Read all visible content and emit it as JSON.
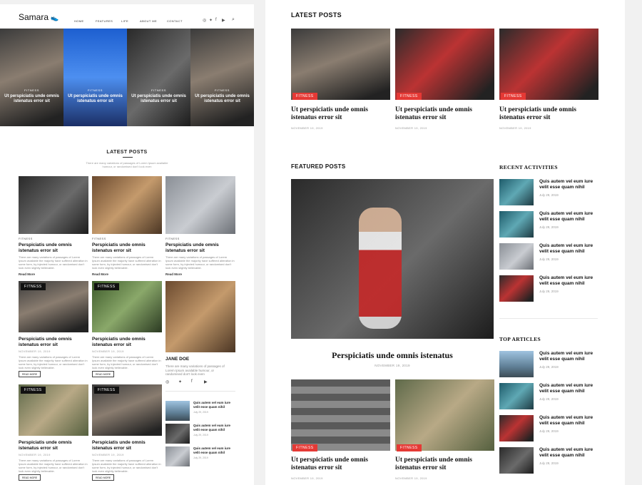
{
  "left": {
    "logo": "Samara",
    "nav": [
      "HOME",
      "FEATURES",
      "LIFE",
      "ABOUT ME",
      "CONTACT"
    ],
    "social_icons": [
      "instagram-icon",
      "twitter-icon",
      "facebook-icon",
      "youtube-icon"
    ],
    "hero": [
      {
        "cat": "FITNESS",
        "title": "Ut perspiciatis unde omnis istenatus error sit"
      },
      {
        "cat": "FITNESS",
        "title": "Ut perspiciatis unde omnis istenatus error sit"
      },
      {
        "cat": "FITNESS",
        "title": "Ut perspiciatis unde omnis istenatus error sit"
      },
      {
        "cat": "FITNESS",
        "title": "Ut perspiciatis unde omnis istenatus error sit"
      }
    ],
    "latest_heading": "LATEST POSTS",
    "latest_sub": "There are many variations of passages of Lorem Ipsum available humour, or randomised don't look even",
    "grid_row1": [
      {
        "cat": "FITNESS",
        "title": "Perspiciatis unde omnis istenatus error sit",
        "excerpt": "There are many variations of passages of Lorem Ipsum available the majority have suffered alteration in some form, by injected humour, or randomised don't look even slightly believable.",
        "more": "Read More"
      },
      {
        "cat": "FITNESS",
        "title": "Perspiciatis unde omnis istenatus error sit",
        "excerpt": "There are many variations of passages of Lorem Ipsum available the majority have suffered alteration in some form, by injected humour, or randomised don't look even slightly believable.",
        "more": "Read More"
      },
      {
        "cat": "FITNESS",
        "title": "Perspiciatis unde omnis istenatus error sit",
        "excerpt": "There are many variations of passages of Lorem Ipsum available the majority have suffered alteration in some form, by injected humour, or randomised don't look even slightly believable.",
        "more": "Read More"
      }
    ],
    "grid_row2": [
      {
        "cat": "FITNESS",
        "title": "Perspiciatis unde omnis istenatus error sit",
        "date": "NOVEMBER 19, 2019",
        "excerpt": "There are many variations of passages of Lorem Ipsum available the majority have suffered alteration in some form, by injected humour, or randomised don't look even slightly believable.",
        "more": "READ MORE"
      },
      {
        "cat": "FITNESS",
        "title": "Perspiciatis unde omnis istenatus error sit",
        "date": "NOVEMBER 19, 2019",
        "excerpt": "There are many variations of passages of Lorem Ipsum available the majority have suffered alteration in some form, by injected humour, or randomised don't look even slightly believable.",
        "more": "READ MORE"
      }
    ],
    "grid_row3": [
      {
        "cat": "FITNESS",
        "title": "Perspiciatis unde omnis istenatus error sit",
        "date": "NOVEMBER 19, 2019",
        "excerpt": "There are many variations of passages of Lorem Ipsum available the majority have suffered alteration in some form, by injected humour, or randomised don't look even slightly believable.",
        "more": "READ MORE"
      },
      {
        "cat": "FITNESS",
        "title": "Perspiciatis unde omnis istenatus error sit",
        "date": "NOVEMBER 19, 2019",
        "excerpt": "There are many variations of passages of Lorem Ipsum available the majority have suffered alteration in some form, by injected humour, or randomised don't look even slightly believable.",
        "more": "READ MORE"
      }
    ],
    "author": {
      "name": "JANE DOE",
      "bio": "There are many variations of passages of Lorem Ipsum available humour, or randomised don't look even"
    },
    "mini_posts": [
      {
        "title": "Quis autem vel eum iure velit esse quam nihil",
        "date": "July 29, 2019"
      },
      {
        "title": "Quis autem vel eum iure velit esse quam nihil",
        "date": "July 29, 2019"
      },
      {
        "title": "Quis autem vel eum iure velit esse quam nihil",
        "date": "July 29, 2019"
      }
    ]
  },
  "right": {
    "latest_heading": "LATEST POSTS",
    "latest": [
      {
        "cat": "FITNESS",
        "title": "Ut perspiciatis unde omnis istenatus error sit",
        "date": "NOVEMBER 19, 2019"
      },
      {
        "cat": "FITNESS",
        "title": "Ut perspiciatis unde omnis istenatus error sit",
        "date": "NOVEMBER 19, 2019"
      },
      {
        "cat": "FITNESS",
        "title": "Ut perspiciatis unde omnis istenatus error sit",
        "date": "NOVEMBER 19, 2019"
      }
    ],
    "featured_heading": "FEATURED POSTS",
    "featured": {
      "title": "Perspiciatis unde omnis istenatus",
      "date": "NOVEMBER 19, 2019"
    },
    "bottom": [
      {
        "cat": "FITNESS",
        "title": "Ut perspiciatis unde omnis istenatus error sit",
        "date": "NOVEMBER 19, 2019"
      },
      {
        "cat": "FITNESS",
        "title": "Ut perspiciatis unde omnis istenatus error sit",
        "date": "NOVEMBER 19, 2019"
      }
    ],
    "recent_heading": "RECENT ACTIVITIES",
    "recent": [
      {
        "title": "Quis autem vel eum iure velit esse quam nihil",
        "date": "July 29, 2019"
      },
      {
        "title": "Quis autem vel eum iure velit esse quam nihil",
        "date": "July 29, 2019"
      },
      {
        "title": "Quis autem vel eum iure velit esse quam nihil",
        "date": "July 29, 2019"
      },
      {
        "title": "Quis autem vel eum iure velit esse quam nihil",
        "date": "July 29, 2019"
      }
    ],
    "top_heading": "TOP ARTICLES",
    "top": [
      {
        "title": "Quis autem vel eum iure velit esse quam nihil",
        "date": "July 29, 2019"
      },
      {
        "title": "Quis autem vel eum iure velit esse quam nihil",
        "date": "July 29, 2019"
      },
      {
        "title": "Quis autem vel eum iure velit esse quam nihil",
        "date": "July 29, 2019"
      },
      {
        "title": "Quis autem vel eum iure velit esse quam nihil",
        "date": "July 29, 2019"
      }
    ]
  },
  "colors": {
    "accent": "#e53935",
    "heading": "#111111",
    "muted": "#999999"
  }
}
